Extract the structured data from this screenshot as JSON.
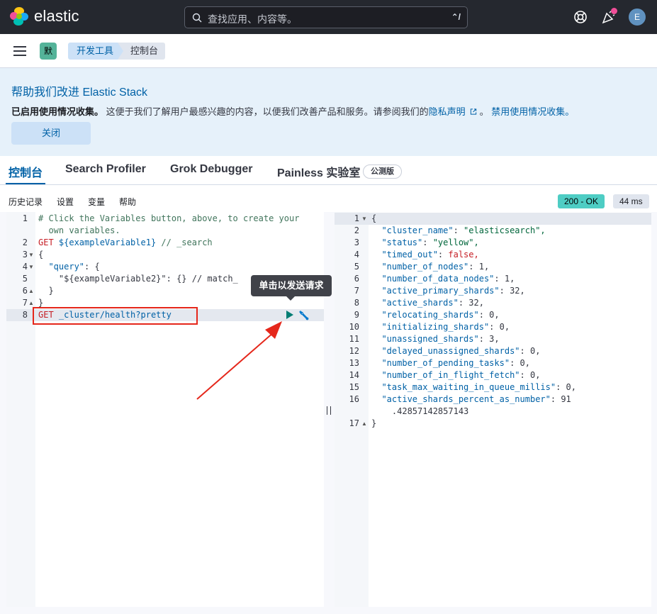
{
  "header": {
    "brand": "elastic",
    "search_placeholder": "查找应用、内容等。",
    "search_shortcut": "⌃/",
    "user_initial": "E"
  },
  "subbar": {
    "space_initial": "默",
    "breadcrumbs": [
      "开发工具",
      "控制台"
    ]
  },
  "callout": {
    "title": "帮助我们改进 Elastic Stack",
    "body_bold": "已启用使用情况收集。",
    "body_text": " 这便于我们了解用户最感兴趣的内容，以便我们改善产品和服务。请参阅我们的",
    "privacy_link": "隐私声明",
    "disable_link": "禁用使用情况收集。",
    "close_label": "关闭"
  },
  "tabs": {
    "console": "控制台",
    "search_profiler": "Search Profiler",
    "grok_debugger": "Grok Debugger",
    "painless": "Painless 实验室",
    "beta_badge": "公测版"
  },
  "toolbar": {
    "history": "历史记录",
    "settings": "设置",
    "variables": "变量",
    "help": "帮助",
    "status": "200 - OK",
    "duration": "44 ms"
  },
  "editor": {
    "line_numbers": [
      "1",
      "",
      "2",
      "3",
      "4",
      "5",
      "6",
      "7",
      "8"
    ],
    "comment_line1": "# Click the Variables button, above, to create your",
    "comment_line2": "  own variables.",
    "line2_method": "GET",
    "line2_url": " ${exampleVariable1}",
    "line2_comment": " // _search",
    "line3": "{",
    "line4_key": "  \"query\"",
    "line4_rest": ": {",
    "line5_key": "    \"${exampleVariable2}\"",
    "line5_rest": ": {} // match_",
    "line6": "  }",
    "line7": "}",
    "line8_method": "GET",
    "line8_url": " _cluster/health?pretty",
    "tooltip": "单击以发送请求"
  },
  "output": {
    "lines": [
      {
        "n": "1",
        "key": "",
        "val": "{",
        "type": "punct"
      },
      {
        "n": "2",
        "key": "  \"cluster_name\"",
        "val": "\"elasticsearch\",",
        "type": "str"
      },
      {
        "n": "3",
        "key": "  \"status\"",
        "val": "\"yellow\",",
        "type": "str"
      },
      {
        "n": "4",
        "key": "  \"timed_out\"",
        "val": "false,",
        "type": "lit"
      },
      {
        "n": "5",
        "key": "  \"number_of_nodes\"",
        "val": "1,",
        "type": "num"
      },
      {
        "n": "6",
        "key": "  \"number_of_data_nodes\"",
        "val": "1,",
        "type": "num"
      },
      {
        "n": "7",
        "key": "  \"active_primary_shards\"",
        "val": "32,",
        "type": "num"
      },
      {
        "n": "8",
        "key": "  \"active_shards\"",
        "val": "32,",
        "type": "num"
      },
      {
        "n": "9",
        "key": "  \"relocating_shards\"",
        "val": "0,",
        "type": "num"
      },
      {
        "n": "10",
        "key": "  \"initializing_shards\"",
        "val": "0,",
        "type": "num"
      },
      {
        "n": "11",
        "key": "  \"unassigned_shards\"",
        "val": "3,",
        "type": "num"
      },
      {
        "n": "12",
        "key": "  \"delayed_unassigned_shards\"",
        "val": "0,",
        "type": "num"
      },
      {
        "n": "13",
        "key": "  \"number_of_pending_tasks\"",
        "val": "0,",
        "type": "num"
      },
      {
        "n": "14",
        "key": "  \"number_of_in_flight_fetch\"",
        "val": "0,",
        "type": "num"
      },
      {
        "n": "15",
        "key": "  \"task_max_waiting_in_queue_millis\"",
        "val": "0,",
        "type": "num"
      },
      {
        "n": "16",
        "key": "  \"active_shards_percent_as_number\"",
        "val": "91",
        "type": "num"
      },
      {
        "n": "",
        "key": "",
        "val": "    .42857142857143",
        "type": "num"
      },
      {
        "n": "17",
        "key": "",
        "val": "}",
        "type": "punct"
      }
    ]
  }
}
